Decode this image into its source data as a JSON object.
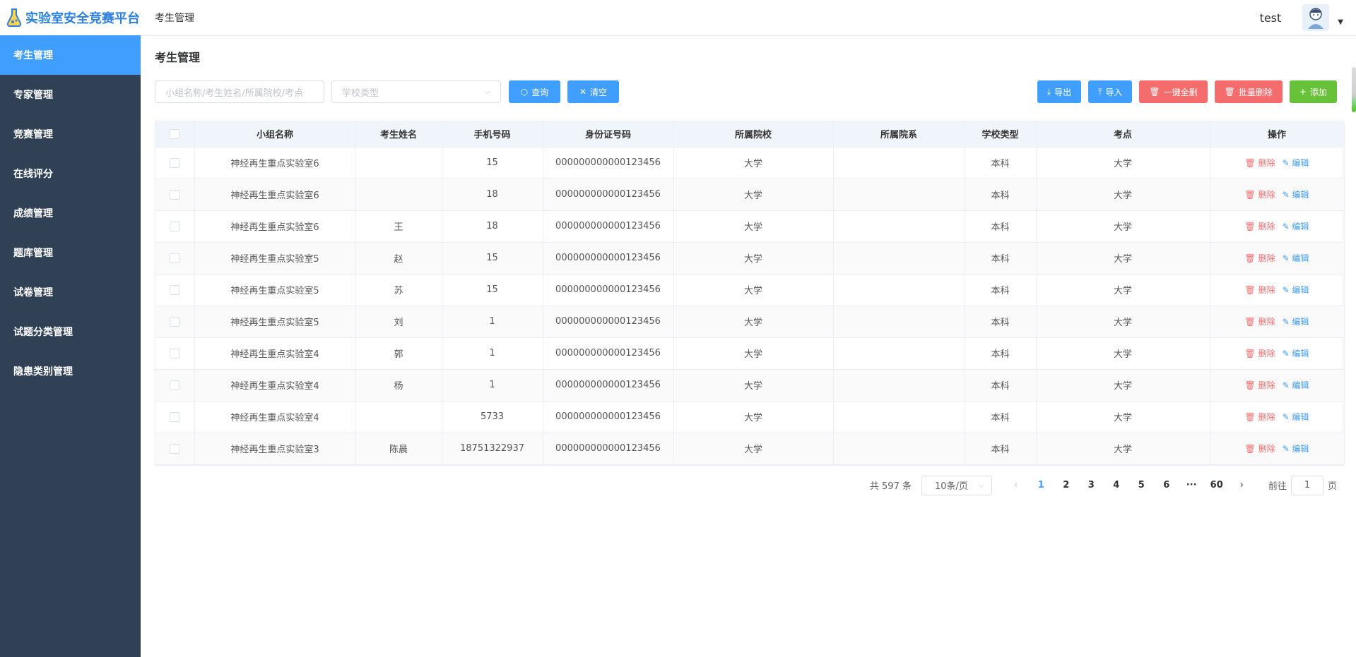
{
  "app": {
    "title": "实验室安全竞赛平台"
  },
  "sidebar": {
    "items": [
      {
        "label": "考生管理",
        "active": true
      },
      {
        "label": "专家管理"
      },
      {
        "label": "竞赛管理"
      },
      {
        "label": "在线评分"
      },
      {
        "label": "成绩管理"
      },
      {
        "label": "题库管理"
      },
      {
        "label": "试卷管理"
      },
      {
        "label": "试题分类管理"
      },
      {
        "label": "隐患类别管理"
      }
    ]
  },
  "header": {
    "breadcrumb": "考生管理",
    "username": "test"
  },
  "page": {
    "title": "考生管理"
  },
  "filters": {
    "search_placeholder": "小组名称/考生姓名/所属院校/考点",
    "school_type_placeholder": "学校类型",
    "query_label": "查询",
    "clear_label": "清空"
  },
  "actions": {
    "export_label": "导出",
    "import_label": "导入",
    "delete_all_label": "一键全删",
    "batch_delete_label": "批量删除",
    "add_label": "添加"
  },
  "table": {
    "columns": [
      "小组名称",
      "考生姓名",
      "手机号码",
      "身份证号码",
      "所属院校",
      "所属院系",
      "学校类型",
      "考点",
      "操作"
    ],
    "delete_label": "删除",
    "edit_label": "编辑",
    "rows": [
      {
        "group": "神经再生重点实验室6",
        "name": "",
        "phone": "15",
        "id_card": "000000000000123456",
        "school": "大学",
        "dept": "",
        "school_type": "本科",
        "site": "大学"
      },
      {
        "group": "神经再生重点实验室6",
        "name": "",
        "phone": "18",
        "id_card": "000000000000123456",
        "school": "大学",
        "dept": "",
        "school_type": "本科",
        "site": "大学"
      },
      {
        "group": "神经再生重点实验室6",
        "name": "王",
        "phone": "18",
        "id_card": "000000000000123456",
        "school": "大学",
        "dept": "",
        "school_type": "本科",
        "site": "大学"
      },
      {
        "group": "神经再生重点实验室5",
        "name": "赵",
        "phone": "15",
        "id_card": "000000000000123456",
        "school": "大学",
        "dept": "",
        "school_type": "本科",
        "site": "大学"
      },
      {
        "group": "神经再生重点实验室5",
        "name": "苏",
        "phone": "15",
        "id_card": "000000000000123456",
        "school": "大学",
        "dept": "",
        "school_type": "本科",
        "site": "大学"
      },
      {
        "group": "神经再生重点实验室5",
        "name": "刘",
        "phone": "1",
        "id_card": "000000000000123456",
        "school": "大学",
        "dept": "",
        "school_type": "本科",
        "site": "大学"
      },
      {
        "group": "神经再生重点实验室4",
        "name": "郭",
        "phone": "1",
        "id_card": "000000000000123456",
        "school": "大学",
        "dept": "",
        "school_type": "本科",
        "site": "大学"
      },
      {
        "group": "神经再生重点实验室4",
        "name": "杨",
        "phone": "1",
        "id_card": "000000000000123456",
        "school": "大学",
        "dept": "",
        "school_type": "本科",
        "site": "大学"
      },
      {
        "group": "神经再生重点实验室4",
        "name": "",
        "phone": "5733",
        "id_card": "000000000000123456",
        "school": "大学",
        "dept": "",
        "school_type": "本科",
        "site": "大学"
      },
      {
        "group": "神经再生重点实验室3",
        "name": "陈晨",
        "phone": "18751322937",
        "id_card": "000000000000123456",
        "school": "大学",
        "dept": "",
        "school_type": "本科",
        "site": "大学"
      }
    ]
  },
  "pagination": {
    "total": "共 597 条",
    "page_size": "10条/页",
    "pages": [
      "1",
      "2",
      "3",
      "4",
      "5",
      "6",
      "···",
      "60"
    ],
    "current": "1",
    "goto_prefix": "前往",
    "goto_value": "1",
    "goto_suffix": "页"
  }
}
